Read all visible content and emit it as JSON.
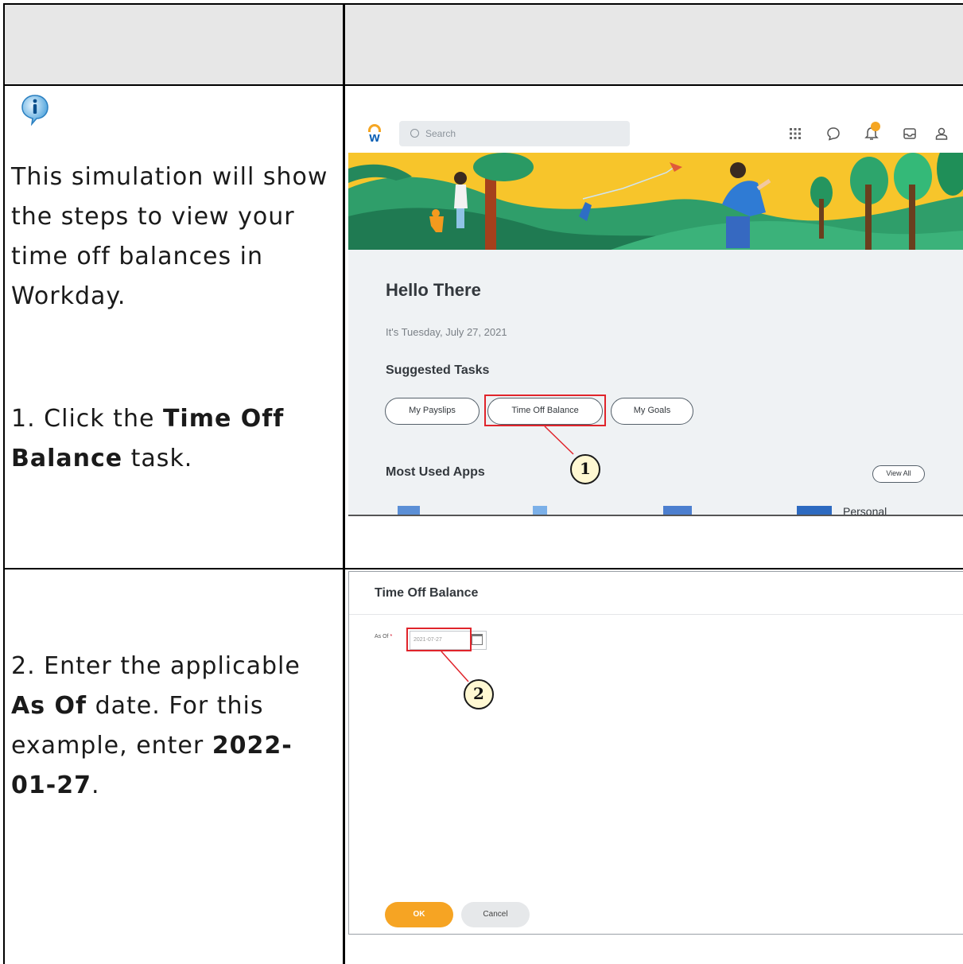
{
  "document": {
    "rows": [
      {
        "intro": "This simulation will show the steps to view your time off balances in Workday.",
        "step_prefix": "1. Click the ",
        "step_bold": "Time Off Balance",
        "step_suffix": " task."
      },
      {
        "step_prefix": "2. Enter the applicable ",
        "step_bold": "As Of",
        "step_mid": " date. For this example, enter ",
        "step_bold2": "2022-01-27",
        "step_suffix": "."
      }
    ]
  },
  "workday_home": {
    "search_placeholder": "Search",
    "logo_letter": "w",
    "greeting": "Hello There",
    "date_line": "It's Tuesday, July 27, 2021",
    "suggested_heading": "Suggested Tasks",
    "tasks": [
      "My Payslips",
      "Time Off Balance",
      "My Goals"
    ],
    "most_used_heading": "Most Used Apps",
    "view_all": "View All",
    "app_partial_label": "Personal",
    "callout": "1",
    "icons": [
      "apps-grid-icon",
      "chat-icon",
      "bell-icon",
      "inbox-icon",
      "profile-icon"
    ]
  },
  "time_off_balance": {
    "title": "Time Off Balance",
    "as_of_label": "As Of",
    "required_mark": "*",
    "date_value": "2021-07-27",
    "ok_button": "OK",
    "cancel_button": "Cancel",
    "callout": "2"
  },
  "colors": {
    "header_fill": "#e7e7e7",
    "highlight_red": "#e0242b",
    "workday_orange": "#f6a423",
    "workday_blue": "#0b5fb4"
  }
}
